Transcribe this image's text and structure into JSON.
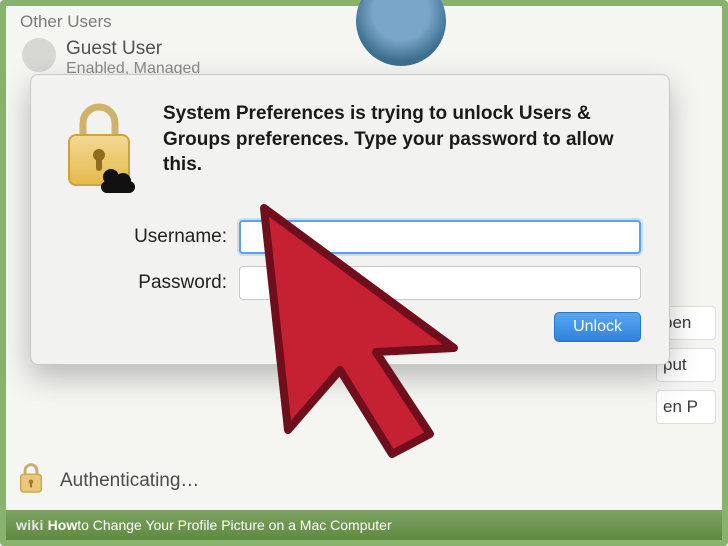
{
  "sidebar": {
    "section_label": "Other Users",
    "user": {
      "name": "Guest User",
      "sub": "Enabled, Managed"
    }
  },
  "dialog": {
    "message": "System Preferences is trying to unlock Users & Groups preferences. Type your password to allow this.",
    "username_label": "Username:",
    "password_label": "Password:",
    "username_value": "",
    "password_value": "",
    "unlock_label": "Unlock"
  },
  "status": {
    "text": "Authenticating…"
  },
  "right_fragments": {
    "a": "pen",
    "b": "put",
    "c": "en P"
  },
  "caption": {
    "brand_prefix": "wiki",
    "brand_bold": "How",
    "title": " to Change Your Profile Picture on a Mac Computer"
  }
}
